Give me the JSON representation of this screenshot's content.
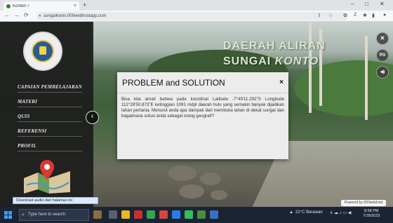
{
  "browser": {
    "tab_title": "Konten 7",
    "tab_close": "×",
    "new_tab": "+",
    "window_controls": [
      "–",
      "□",
      "✕"
    ],
    "url": "sungaikonto.000webhostapp.com",
    "nav": [
      "←",
      "→",
      "⟳"
    ]
  },
  "sidebar": {
    "menu": [
      "CAPAIAN PEMBELAJARAN",
      "MATERI",
      "QUIS",
      "REFERENSI",
      "PROFIL"
    ],
    "collapse_icon": "‹"
  },
  "header": {
    "title_line1": "DAERAH ALIRAN",
    "title_line2a": "SUNGAI ",
    "title_line2b": "KONTO"
  },
  "side_buttons": {
    "close": "✕",
    "pg": "PG",
    "sound": "◀)"
  },
  "modal": {
    "title": "PROBLEM and SOLUTION",
    "close": "×",
    "body": "Bisa kita amati bahwa pada koordinat Latitude -7°49'11.292\"S Longitude 112°28'50.873\"E ketinggian 1091 mdpl daerah hulu yang semakin banyak dijadikan lahan pertania. Menurut anda apa dampak dari membuka lahan di dekat sungai dan bagaimana solusi anda sebagai orang geografi?"
  },
  "download_bar": "Download audio dari halaman ini",
  "powered_by": "Powered by 000webhost",
  "taskbar": {
    "search_placeholder": "Type here to search",
    "weather": "22°C Berawan",
    "clock_time": "8:58 PM",
    "clock_date": "7/18/2023"
  }
}
